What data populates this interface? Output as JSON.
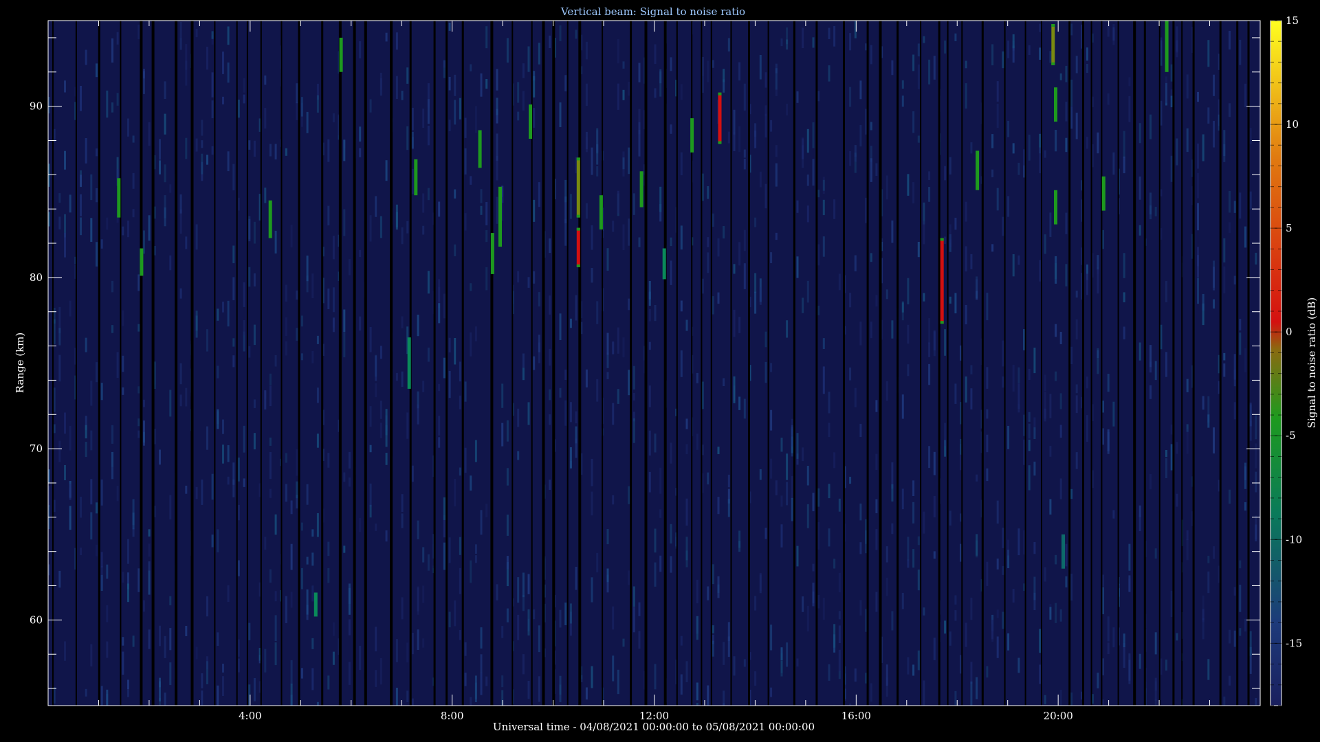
{
  "chart_data": {
    "type": "heatmap",
    "title": "Vertical beam: Signal to noise ratio",
    "xlabel": "Universal time - 04/08/2021 00:00:00 to 05/08/2021 00:00:00",
    "ylabel": "Range (km)",
    "xlim": [
      0,
      24
    ],
    "ylim": [
      55,
      95
    ],
    "x_ticks": [
      {
        "value": 4,
        "label": "4:00"
      },
      {
        "value": 8,
        "label": "8:00"
      },
      {
        "value": 12,
        "label": "12:00"
      },
      {
        "value": 16,
        "label": "16:00"
      },
      {
        "value": 20,
        "label": "20:00"
      }
    ],
    "y_ticks": [
      {
        "value": 60,
        "label": "60"
      },
      {
        "value": 70,
        "label": "70"
      },
      {
        "value": 80,
        "label": "80"
      },
      {
        "value": 90,
        "label": "90"
      }
    ],
    "colorbar": {
      "label": "Signal to noise ratio (dB)",
      "range": [
        -18,
        15
      ],
      "ticks": [
        {
          "value": -15,
          "label": "-15"
        },
        {
          "value": -10,
          "label": "-10"
        },
        {
          "value": -5,
          "label": "-5"
        },
        {
          "value": 0,
          "label": "0"
        },
        {
          "value": 5,
          "label": "5"
        },
        {
          "value": 10,
          "label": "10"
        },
        {
          "value": 15,
          "label": "15"
        }
      ],
      "colors": [
        "#1a1f5e",
        "#1d3a7a",
        "#0a7a5a",
        "#1e9a1e",
        "#8a6a10",
        "#d41010",
        "#e07a10",
        "#ffff20"
      ]
    },
    "background_snr_db": -17,
    "echoes": [
      {
        "t": 1.4,
        "r0": 83.5,
        "r1": 85.8,
        "snr": -5
      },
      {
        "t": 1.85,
        "r0": 80.1,
        "r1": 81.7,
        "snr": -5
      },
      {
        "t": 4.4,
        "r0": 82.3,
        "r1": 84.5,
        "snr": -4
      },
      {
        "t": 5.8,
        "r0": 92.0,
        "r1": 94.0,
        "snr": -4
      },
      {
        "t": 5.3,
        "r0": 60.2,
        "r1": 61.6,
        "snr": -8
      },
      {
        "t": 7.15,
        "r0": 73.5,
        "r1": 76.5,
        "snr": -6
      },
      {
        "t": 7.28,
        "r0": 84.8,
        "r1": 86.9,
        "snr": -3
      },
      {
        "t": 8.55,
        "r0": 86.4,
        "r1": 88.6,
        "snr": -4
      },
      {
        "t": 8.8,
        "r0": 80.2,
        "r1": 82.6,
        "snr": -3
      },
      {
        "t": 8.95,
        "r0": 81.8,
        "r1": 85.3,
        "snr": -5
      },
      {
        "t": 9.55,
        "r0": 88.1,
        "r1": 90.1,
        "snr": -5
      },
      {
        "t": 10.5,
        "r0": 83.5,
        "r1": 87.0,
        "snr": -2
      },
      {
        "t": 10.5,
        "r0": 80.6,
        "r1": 82.9,
        "snr": 1
      },
      {
        "t": 10.95,
        "r0": 82.8,
        "r1": 84.8,
        "snr": -4
      },
      {
        "t": 11.75,
        "r0": 84.1,
        "r1": 86.2,
        "snr": -4
      },
      {
        "t": 12.2,
        "r0": 79.9,
        "r1": 81.7,
        "snr": -6
      },
      {
        "t": 12.75,
        "r0": 87.3,
        "r1": 89.3,
        "snr": -4
      },
      {
        "t": 13.3,
        "r0": 87.8,
        "r1": 90.8,
        "snr": 2
      },
      {
        "t": 17.7,
        "r0": 77.3,
        "r1": 82.3,
        "snr": 1
      },
      {
        "t": 18.4,
        "r0": 85.1,
        "r1": 87.4,
        "snr": -3
      },
      {
        "t": 19.9,
        "r0": 92.4,
        "r1": 94.8,
        "snr": -1
      },
      {
        "t": 19.95,
        "r0": 89.1,
        "r1": 91.1,
        "snr": -4
      },
      {
        "t": 19.95,
        "r0": 83.1,
        "r1": 85.1,
        "snr": -4
      },
      {
        "t": 20.1,
        "r0": 63.0,
        "r1": 65.0,
        "snr": -9
      },
      {
        "t": 20.9,
        "r0": 83.9,
        "r1": 85.9,
        "snr": -4
      },
      {
        "t": 22.15,
        "r0": 92.0,
        "r1": 95.0,
        "snr": -4
      }
    ]
  }
}
